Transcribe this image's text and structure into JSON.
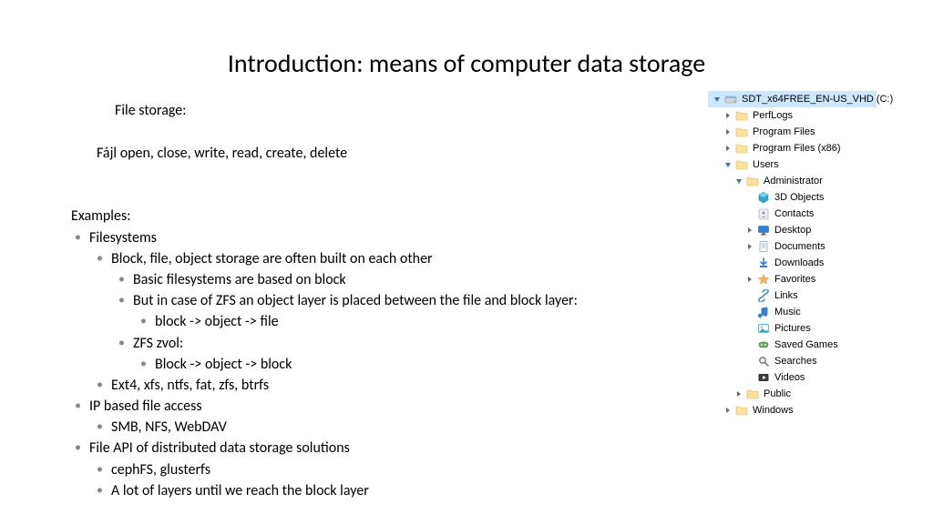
{
  "title": "Introduction: means of computer data storage",
  "file_storage_label": "File storage:",
  "file_ops": "Fájl open, close, write, read, create, delete",
  "examples_label": "Examples:",
  "bullets": {
    "filesystems": "Filesystems",
    "block_file_object": "Block, file, object storage are often built on each other",
    "basic_fs": "Basic filesystems are based on block",
    "zfs_object1": "But in case of ZFS an object layer is placed between the file and block layer:",
    "zfs_object1_chain": "block -> object -> file",
    "zfs_zvol": "ZFS zvol:",
    "zfs_zvol_chain": "Block -> object -> block",
    "ext4": "Ext4, xfs, ntfs, fat, zfs, btrfs",
    "ip_based": "IP based file access",
    "ip_list": "SMB, NFS, WebDAV",
    "file_api": "File API of distributed data storage solutions",
    "cephfs": "cephFS, glusterfs",
    "layers": "A lot of layers until we reach the block layer"
  },
  "tree": [
    {
      "indent": 0,
      "arrow": "open",
      "icon": "drive",
      "label": "SDT_x64FREE_EN-US_VHD (C:)",
      "selected": true
    },
    {
      "indent": 1,
      "arrow": "closed",
      "icon": "folder",
      "label": "PerfLogs"
    },
    {
      "indent": 1,
      "arrow": "closed",
      "icon": "folder",
      "label": "Program Files"
    },
    {
      "indent": 1,
      "arrow": "closed",
      "icon": "folder",
      "label": "Program Files (x86)"
    },
    {
      "indent": 1,
      "arrow": "open",
      "icon": "folder",
      "label": "Users"
    },
    {
      "indent": 2,
      "arrow": "open",
      "icon": "folder",
      "label": "Administrator"
    },
    {
      "indent": 3,
      "arrow": "none",
      "icon": "3dobj",
      "label": "3D Objects"
    },
    {
      "indent": 3,
      "arrow": "none",
      "icon": "contacts",
      "label": "Contacts"
    },
    {
      "indent": 3,
      "arrow": "closed",
      "icon": "desktop",
      "label": "Desktop"
    },
    {
      "indent": 3,
      "arrow": "closed",
      "icon": "documents",
      "label": "Documents"
    },
    {
      "indent": 3,
      "arrow": "none",
      "icon": "downloads",
      "label": "Downloads"
    },
    {
      "indent": 3,
      "arrow": "closed",
      "icon": "favorites",
      "label": "Favorites"
    },
    {
      "indent": 3,
      "arrow": "none",
      "icon": "links",
      "label": "Links"
    },
    {
      "indent": 3,
      "arrow": "none",
      "icon": "music",
      "label": "Music"
    },
    {
      "indent": 3,
      "arrow": "none",
      "icon": "pictures",
      "label": "Pictures"
    },
    {
      "indent": 3,
      "arrow": "none",
      "icon": "games",
      "label": "Saved Games"
    },
    {
      "indent": 3,
      "arrow": "none",
      "icon": "searches",
      "label": "Searches"
    },
    {
      "indent": 3,
      "arrow": "none",
      "icon": "videos",
      "label": "Videos"
    },
    {
      "indent": 2,
      "arrow": "closed",
      "icon": "folder",
      "label": "Public"
    },
    {
      "indent": 1,
      "arrow": "closed",
      "icon": "folder",
      "label": "Windows"
    }
  ]
}
